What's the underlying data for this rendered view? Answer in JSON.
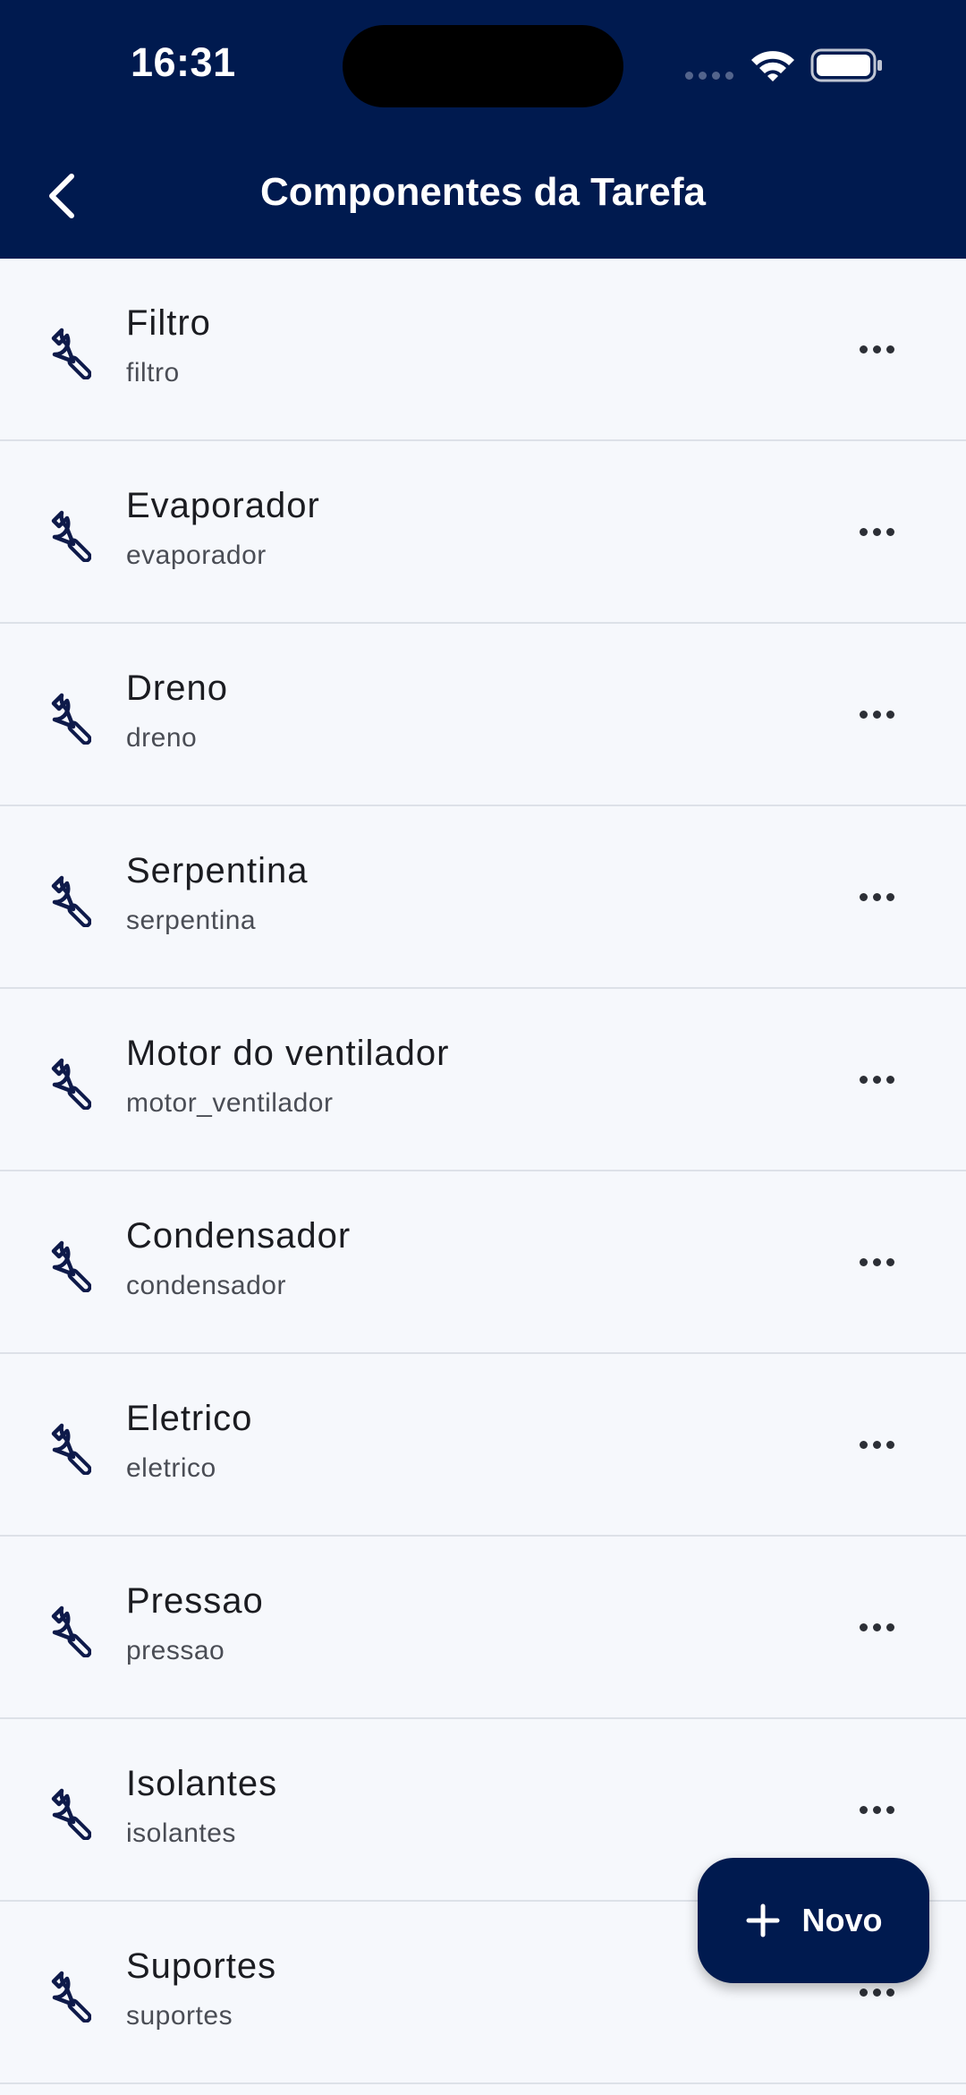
{
  "status_bar": {
    "time": "16:31",
    "icons": [
      "cellular-signal-icon",
      "wifi-icon",
      "battery-icon"
    ]
  },
  "header": {
    "title": "Componentes da Tarefa",
    "back_icon": "chevron-left-icon"
  },
  "colors": {
    "header_bg": "#001a4f",
    "page_bg": "#f6f8fc",
    "icon": "#0e1a4a",
    "divider": "#dde1e8"
  },
  "components": [
    {
      "name": "Filtro",
      "key": "filtro",
      "icon": "wrench-icon"
    },
    {
      "name": "Evaporador",
      "key": "evaporador",
      "icon": "wrench-icon"
    },
    {
      "name": "Dreno",
      "key": "dreno",
      "icon": "wrench-icon"
    },
    {
      "name": "Serpentina",
      "key": "serpentina",
      "icon": "wrench-icon"
    },
    {
      "name": "Motor do ventilador",
      "key": "motor_ventilador",
      "icon": "wrench-icon"
    },
    {
      "name": "Condensador",
      "key": "condensador",
      "icon": "wrench-icon"
    },
    {
      "name": "Eletrico",
      "key": "eletrico",
      "icon": "wrench-icon"
    },
    {
      "name": "Pressao",
      "key": "pressao",
      "icon": "wrench-icon"
    },
    {
      "name": "Isolantes",
      "key": "isolantes",
      "icon": "wrench-icon"
    },
    {
      "name": "Suportes",
      "key": "suportes",
      "icon": "wrench-icon"
    }
  ],
  "fab": {
    "label": "Novo",
    "icon": "plus-icon"
  }
}
